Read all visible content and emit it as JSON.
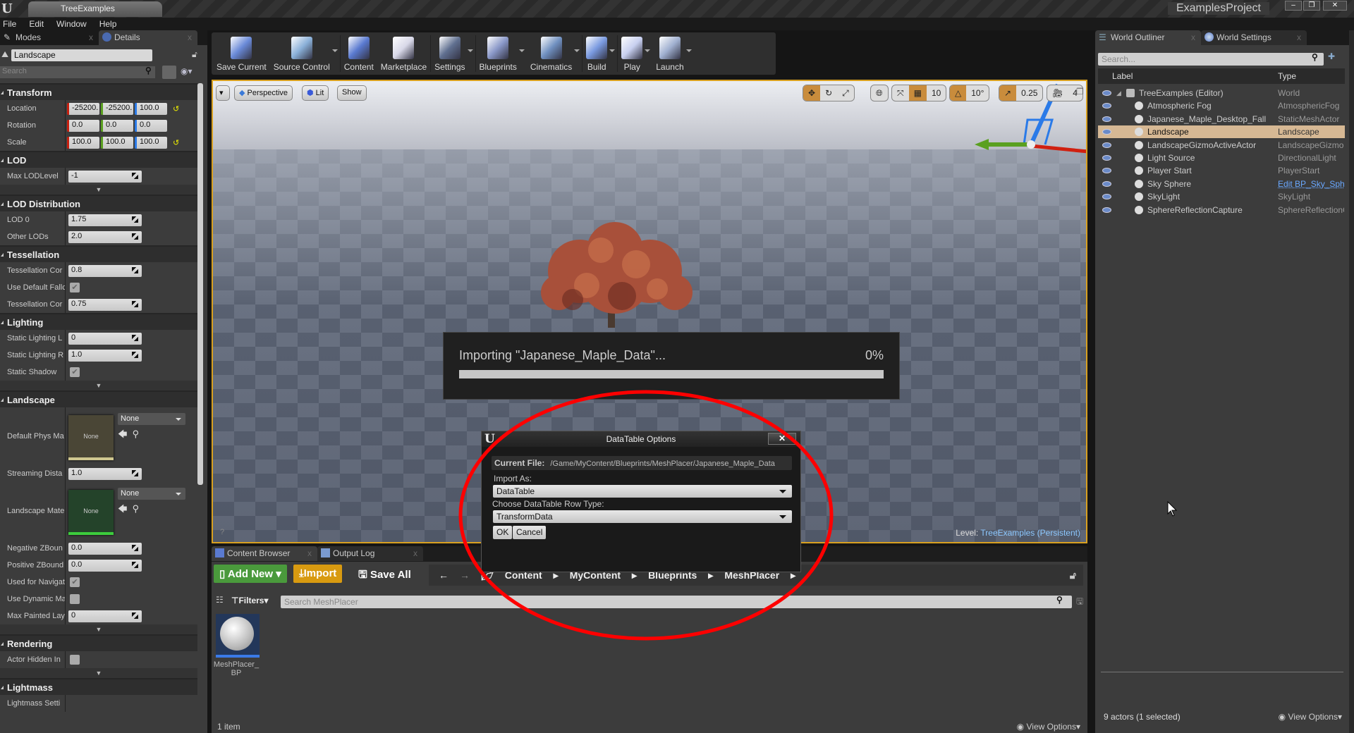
{
  "window": {
    "tab_title": "TreeExamples",
    "project": "ExamplesProject"
  },
  "menu": [
    "File",
    "Edit",
    "Window",
    "Help"
  ],
  "left_panel": {
    "tabs": [
      "Modes",
      "Details"
    ],
    "actor_name": "Landscape",
    "search_placeholder": "Search",
    "sections": [
      {
        "title": "Transform",
        "rows": [
          {
            "label": "Location",
            "type": "vec",
            "values": [
              "-25200.",
              "-25200.",
              "100.0"
            ],
            "reset": true
          },
          {
            "label": "Rotation",
            "type": "vec",
            "values": [
              "0.0",
              "0.0",
              "0.0"
            ]
          },
          {
            "label": "Scale",
            "type": "vec",
            "values": [
              "100.0",
              "100.0",
              "100.0"
            ],
            "reset": true
          }
        ]
      },
      {
        "title": "LOD",
        "rows": [
          {
            "label": "Max LODLevel",
            "type": "num",
            "value": "-1"
          }
        ],
        "expander": true
      },
      {
        "title": "LOD Distribution",
        "rows": [
          {
            "label": "LOD 0",
            "type": "num",
            "value": "1.75"
          },
          {
            "label": "Other LODs",
            "type": "num",
            "value": "2.0"
          }
        ]
      },
      {
        "title": "Tessellation",
        "rows": [
          {
            "label": "Tessellation Cor",
            "type": "num",
            "value": "0.8"
          },
          {
            "label": "Use Default Fallc",
            "type": "check",
            "checked": true
          },
          {
            "label": "Tessellation Cor",
            "type": "num",
            "value": "0.75"
          }
        ]
      },
      {
        "title": "Lighting",
        "rows": [
          {
            "label": "Static Lighting L",
            "type": "num",
            "value": "0"
          },
          {
            "label": "Static Lighting R",
            "type": "num",
            "value": "1.0"
          },
          {
            "label": "Static Shadow",
            "type": "check",
            "checked": true
          }
        ],
        "expander": true
      },
      {
        "title": "Landscape",
        "rows": [
          {
            "label": "Default Phys Ma",
            "type": "asset",
            "thumb": "None",
            "value": "None",
            "color": "#4a4636",
            "bar": "#d0c890"
          },
          {
            "label": "Streaming Dista",
            "type": "num",
            "value": "1.0"
          },
          {
            "label": "Landscape Mate",
            "type": "asset",
            "thumb": "None",
            "value": "None",
            "color": "#24432a",
            "bar": "#3ccc3c"
          },
          {
            "label": "Negative ZBoun",
            "type": "num",
            "value": "0.0"
          },
          {
            "label": "Positive ZBound",
            "type": "num",
            "value": "0.0"
          },
          {
            "label": "Used for Navigat",
            "type": "check",
            "checked": true
          },
          {
            "label": "Use Dynamic Ma",
            "type": "check",
            "checked": false
          },
          {
            "label": "Max Painted Lay",
            "type": "num",
            "value": "0"
          }
        ],
        "expander": true
      },
      {
        "title": "Rendering",
        "rows": [
          {
            "label": "Actor Hidden In",
            "type": "check",
            "checked": false
          }
        ],
        "expander": true
      },
      {
        "title": "Lightmass",
        "rows": [
          {
            "label": "Lightmass Setti",
            "type": "text"
          }
        ]
      }
    ]
  },
  "toolbar": [
    {
      "label": "Save Current",
      "color": "#6a8ad8"
    },
    {
      "label": "Source Control",
      "color": "#8ab0d8",
      "dd": true
    },
    {
      "label": "Content",
      "color": "#5a7ad0",
      "sep": true
    },
    {
      "label": "Marketplace",
      "color": "#d8d8e8"
    },
    {
      "label": "Settings",
      "color": "#607090",
      "dd": true,
      "sep": true
    },
    {
      "label": "Blueprints",
      "color": "#8a98c8",
      "dd": true,
      "sep": true
    },
    {
      "label": "Cinematics",
      "color": "#7090c0",
      "dd": true
    },
    {
      "label": "Build",
      "color": "#7a9ae0",
      "dd": true,
      "sep": true
    },
    {
      "label": "Play",
      "color": "#c8d0f0",
      "dd": true,
      "sep": true
    },
    {
      "label": "Launch",
      "color": "#a0b0d0",
      "dd": true
    }
  ],
  "viewport": {
    "perspective": "Perspective",
    "lit": "Lit",
    "show": "Show",
    "grid_snap": "10",
    "rot_snap": "10°",
    "scale_snap": "0.25",
    "cam_speed": "4",
    "level_label": "Level:",
    "level_name": "TreeExamples (Persistent)"
  },
  "import_progress": {
    "text": "Importing \"Japanese_Maple_Data\"...",
    "percent_label": "0%",
    "percent": 0
  },
  "datatable_dialog": {
    "title": "DataTable Options",
    "close": "✕",
    "current_file_label": "Current File:",
    "current_file": "/Game/MyContent/Blueprints/MeshPlacer/Japanese_Maple_Data",
    "import_as_label": "Import As:",
    "import_as": "DataTable",
    "row_type_label": "Choose DataTable Row Type:",
    "row_type": "TransformData",
    "ok": "OK",
    "cancel": "Cancel"
  },
  "content_browser": {
    "tabs": [
      "Content Browser",
      "Output Log"
    ],
    "add_new": "Add New",
    "import": "Import",
    "save_all": "Save All",
    "breadcrumb": [
      "Content",
      "MyContent",
      "Blueprints",
      "MeshPlacer"
    ],
    "filters": "Filters",
    "search_placeholder": "Search MeshPlacer",
    "items": [
      {
        "name": "MeshPlacer_ BP"
      }
    ],
    "count": "1 item",
    "view_options": "View Options"
  },
  "outliner": {
    "tabs": [
      "World Outliner",
      "World Settings"
    ],
    "search_placeholder": "Search...",
    "col_label": "Label",
    "col_type": "Type",
    "rows": [
      {
        "label": "TreeExamples (Editor)",
        "type": "World",
        "root": true
      },
      {
        "label": "Atmospheric Fog",
        "type": "AtmosphericFog"
      },
      {
        "label": "Japanese_Maple_Desktop_Fall",
        "type": "StaticMeshActor"
      },
      {
        "label": "Landscape",
        "type": "Landscape",
        "selected": true
      },
      {
        "label": "LandscapeGizmoActiveActor",
        "type": "LandscapeGizmo..."
      },
      {
        "label": "Light Source",
        "type": "DirectionalLight"
      },
      {
        "label": "Player Start",
        "type": "PlayerStart"
      },
      {
        "label": "Sky Sphere",
        "type": "Edit BP_Sky_Sphere",
        "link": true
      },
      {
        "label": "SkyLight",
        "type": "SkyLight"
      },
      {
        "label": "SphereReflectionCapture",
        "type": "SphereReflectionCapture"
      }
    ],
    "status": "9 actors (1 selected)",
    "view_options": "View Options"
  },
  "colors": {
    "accent": "#d8a020",
    "annotation": "#ff0000",
    "selection": "#d6b894",
    "add_new": "#4a9a3c",
    "import": "#d89a10"
  }
}
